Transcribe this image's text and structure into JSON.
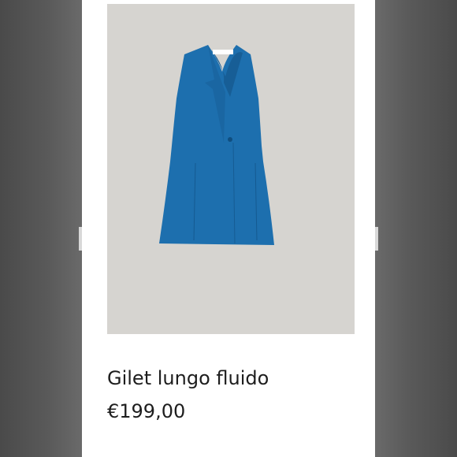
{
  "product": {
    "name": "Gilet lungo fluido",
    "price": "€199,00",
    "image_alt": "Blue long fluid vest with lapel collar",
    "colors": {
      "garment": "#1d6fae",
      "garment_shadow": "#175e96",
      "image_background": "#d6d4d0"
    }
  }
}
